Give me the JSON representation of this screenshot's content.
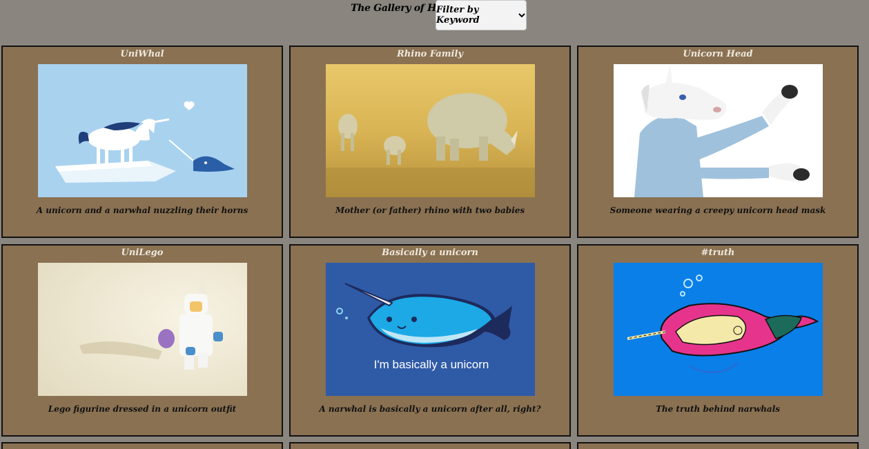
{
  "header": {
    "title": "The Gallery of Horns",
    "filter_label": "Filter by Keyword"
  },
  "cards": [
    {
      "title": "UniWhal",
      "description": "A unicorn and a narwhal nuzzling their horns",
      "image": "unicorn-narwhal-illustration"
    },
    {
      "title": "Rhino Family",
      "description": "Mother (or father) rhino with two babies",
      "image": "rhino-family-photo"
    },
    {
      "title": "Unicorn Head",
      "description": "Someone wearing a creepy unicorn head mask",
      "image": "unicorn-mask-photo"
    },
    {
      "title": "UniLego",
      "description": "Lego figurine dressed in a unicorn outfit",
      "image": "lego-unicorn-photo"
    },
    {
      "title": "Basically a unicorn",
      "description": "A narwhal is basically a unicorn after all, right?",
      "image": "narwhal-cartoon",
      "image_text": "I'm basically a unicorn"
    },
    {
      "title": "#truth",
      "description": "The truth behind narwhals",
      "image": "narwhal-drawing"
    }
  ],
  "colors": {
    "page_background": "#8a857f",
    "card_background": "#8a7152",
    "card_border": "#111111",
    "card_title": "#efe9de"
  }
}
